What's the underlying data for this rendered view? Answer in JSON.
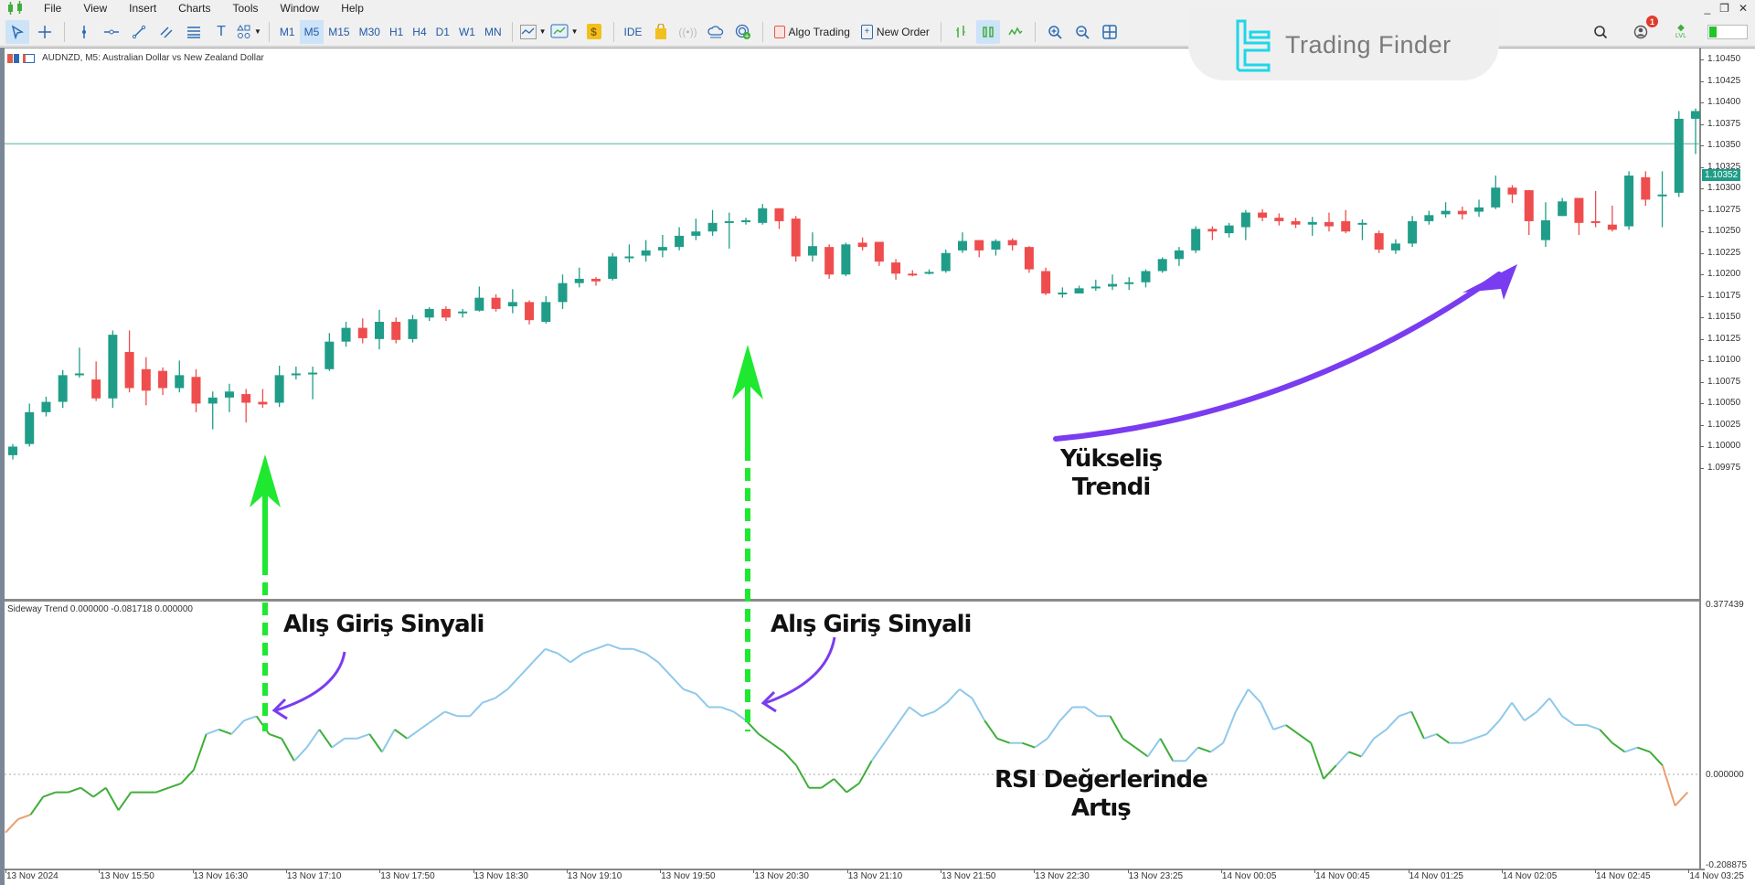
{
  "menu": {
    "items": [
      "File",
      "View",
      "Insert",
      "Charts",
      "Tools",
      "Window",
      "Help"
    ]
  },
  "toolbar": {
    "draw_tools": [
      "cursor-icon",
      "crosshair-icon",
      "vertical-line-icon",
      "horizontal-line-icon",
      "trendline-icon",
      "channel-icon",
      "fibonacci-icon",
      "text-icon",
      "shapes-icon"
    ],
    "timeframes": [
      "M1",
      "M5",
      "M15",
      "M30",
      "H1",
      "H4",
      "D1",
      "W1",
      "MN"
    ],
    "active_timeframe": "M5",
    "ide_label": "IDE",
    "algo_trading_label": "Algo Trading",
    "new_order_label": "New Order"
  },
  "window": {
    "minimize": "_",
    "restore": "❐",
    "close": "✕"
  },
  "notifications": {
    "count": "1"
  },
  "branding": {
    "name": "Trading Finder",
    "accent": "#1fd6e8"
  },
  "chart": {
    "symbol_title": "AUDNZD, M5:  Australian Dollar vs New Zealand Dollar",
    "current_price": "1.10352",
    "bull_color": "#1f9d88",
    "bear_color": "#ef4d4d"
  },
  "indicator": {
    "title": "Sideway Trend 0.000000 -0.081718 0.000000",
    "axis_top": "0.377439",
    "axis_zero": "0.000000",
    "axis_bottom": "-0.208875",
    "colors": {
      "neutral": "#8ec9ea",
      "up": "#3fae3a",
      "down": "#e8a070"
    }
  },
  "annotations": {
    "signal_1": "Alış Giriş Sinyali",
    "signal_2": "Alış Giriş Sinyali",
    "trend_line1": "Yükseliş",
    "trend_line2": "Trendi",
    "rsi_line1": "RSI Değerlerinde",
    "rsi_line2": "Artış",
    "arrow_color": "#7a3cf0",
    "signal_color": "#1ee830"
  },
  "chart_data": [
    {
      "type": "candlestick",
      "title": "AUDNZD, M5",
      "y_ticks": [
        "1.10450",
        "1.10425",
        "1.10400",
        "1.10375",
        "1.10350",
        "1.10325",
        "1.10300",
        "1.10275",
        "1.10250",
        "1.10225",
        "1.10200",
        "1.10175",
        "1.10150",
        "1.10125",
        "1.10100",
        "1.10075",
        "1.10050",
        "1.10025",
        "1.10000",
        "1.09975"
      ],
      "ylim": [
        1.0996,
        1.1048
      ],
      "x_ticks": [
        "13 Nov 2024",
        "13 Nov 15:50",
        "13 Nov 16:30",
        "13 Nov 17:10",
        "13 Nov 17:50",
        "13 Nov 18:30",
        "13 Nov 19:10",
        "13 Nov 19:50",
        "13 Nov 20:30",
        "13 Nov 21:10",
        "13 Nov 21:50",
        "13 Nov 22:30",
        "13 Nov 23:25",
        "14 Nov 00:05",
        "14 Nov 00:45",
        "14 Nov 01:25",
        "14 Nov 02:05",
        "14 Nov 02:45",
        "14 Nov 03:25"
      ],
      "horizontal_line": 1.10352,
      "ohlc": [
        [
          1.0999,
          1.1,
          1.09985,
          1.10003
        ],
        [
          1.10003,
          1.1004,
          1.1,
          1.1005
        ],
        [
          1.1004,
          1.10052,
          1.10035,
          1.10058
        ],
        [
          1.10052,
          1.10083,
          1.10045,
          1.10089
        ],
        [
          1.10083,
          1.10085,
          1.1008,
          1.10115
        ],
        [
          1.10078,
          1.10056,
          1.10053,
          1.10099
        ],
        [
          1.10056,
          1.1013,
          1.10045,
          1.10135
        ],
        [
          1.1011,
          1.10068,
          1.10063,
          1.10135
        ],
        [
          1.1009,
          1.10065,
          1.10048,
          1.10104
        ],
        [
          1.10088,
          1.10068,
          1.1006,
          1.10092
        ],
        [
          1.10068,
          1.10083,
          1.10063,
          1.101
        ],
        [
          1.10081,
          1.1005,
          1.1004,
          1.1009
        ],
        [
          1.1005,
          1.10057,
          1.1002,
          1.10064
        ],
        [
          1.10057,
          1.10064,
          1.1004,
          1.10073
        ],
        [
          1.10061,
          1.10051,
          1.10028,
          1.10067
        ],
        [
          1.10052,
          1.10049,
          1.10045,
          1.10067
        ],
        [
          1.10051,
          1.10083,
          1.10046,
          1.10094
        ],
        [
          1.10083,
          1.10085,
          1.10078,
          1.10093
        ],
        [
          1.10086,
          1.10086,
          1.10055,
          1.10093
        ],
        [
          1.1009,
          1.10122,
          1.10088,
          1.10132
        ],
        [
          1.10122,
          1.10138,
          1.10116,
          1.10145
        ],
        [
          1.10138,
          1.10126,
          1.1012,
          1.10149
        ],
        [
          1.10125,
          1.10145,
          1.10113,
          1.10159
        ],
        [
          1.10145,
          1.10124,
          1.1012,
          1.1015
        ],
        [
          1.10125,
          1.10148,
          1.10121,
          1.10153
        ],
        [
          1.1015,
          1.1016,
          1.10146,
          1.10162
        ],
        [
          1.1016,
          1.1015,
          1.10146,
          1.10163
        ],
        [
          1.10155,
          1.10157,
          1.1015,
          1.1016
        ],
        [
          1.10158,
          1.10173,
          1.10157,
          1.10186
        ],
        [
          1.10173,
          1.1016,
          1.10157,
          1.10177
        ],
        [
          1.10163,
          1.10168,
          1.10155,
          1.10183
        ],
        [
          1.10168,
          1.10147,
          1.10142,
          1.1017
        ],
        [
          1.10145,
          1.10168,
          1.10143,
          1.10175
        ],
        [
          1.10168,
          1.1019,
          1.1016,
          1.102
        ],
        [
          1.1019,
          1.10195,
          1.10185,
          1.10208
        ],
        [
          1.10195,
          1.10192,
          1.10187,
          1.10197
        ],
        [
          1.10195,
          1.10221,
          1.10193,
          1.10225
        ],
        [
          1.10221,
          1.10221,
          1.10214,
          1.10235
        ],
        [
          1.10222,
          1.10228,
          1.10215,
          1.1024
        ],
        [
          1.10228,
          1.10232,
          1.1022,
          1.10246
        ],
        [
          1.10232,
          1.10245,
          1.10228,
          1.10255
        ],
        [
          1.10245,
          1.1025,
          1.1024,
          1.10265
        ],
        [
          1.1025,
          1.1026,
          1.10245,
          1.10275
        ],
        [
          1.10262,
          1.10262,
          1.1023,
          1.10272
        ],
        [
          1.10262,
          1.10263,
          1.10258,
          1.10266
        ],
        [
          1.1026,
          1.10277,
          1.10258,
          1.10282
        ],
        [
          1.10277,
          1.10262,
          1.10253,
          1.10277
        ],
        [
          1.10265,
          1.10221,
          1.10215,
          1.10268
        ],
        [
          1.10222,
          1.10233,
          1.10215,
          1.10249
        ],
        [
          1.10232,
          1.102,
          1.10195,
          1.10235
        ],
        [
          1.102,
          1.10235,
          1.10198,
          1.10237
        ],
        [
          1.10237,
          1.10232,
          1.10228,
          1.10243
        ],
        [
          1.10238,
          1.10215,
          1.1021,
          1.10238
        ],
        [
          1.10214,
          1.10201,
          1.10194,
          1.10218
        ],
        [
          1.10201,
          1.10199,
          1.10198,
          1.10205
        ],
        [
          1.10201,
          1.10203,
          1.102,
          1.10206
        ],
        [
          1.10204,
          1.10225,
          1.10202,
          1.10229
        ],
        [
          1.10228,
          1.10239,
          1.10225,
          1.10249
        ],
        [
          1.1024,
          1.10228,
          1.1022,
          1.1024
        ],
        [
          1.10229,
          1.10239,
          1.10222,
          1.10241
        ],
        [
          1.1024,
          1.10234,
          1.10228,
          1.10242
        ],
        [
          1.10232,
          1.10206,
          1.10202,
          1.10233
        ],
        [
          1.10204,
          1.10178,
          1.10176,
          1.10208
        ],
        [
          1.10178,
          1.10179,
          1.10173,
          1.10185
        ],
        [
          1.10178,
          1.10184,
          1.10178,
          1.10187
        ],
        [
          1.10184,
          1.10186,
          1.10181,
          1.10194
        ],
        [
          1.10186,
          1.10189,
          1.10182,
          1.102
        ],
        [
          1.10189,
          1.10191,
          1.10182,
          1.10197
        ],
        [
          1.10191,
          1.10204,
          1.10185,
          1.10206
        ],
        [
          1.10204,
          1.10218,
          1.10202,
          1.1022
        ],
        [
          1.10218,
          1.10228,
          1.1021,
          1.10232
        ],
        [
          1.10228,
          1.10253,
          1.10225,
          1.10256
        ],
        [
          1.10253,
          1.1025,
          1.1024,
          1.10256
        ],
        [
          1.10248,
          1.10257,
          1.10243,
          1.1026
        ],
        [
          1.10255,
          1.10272,
          1.1024,
          1.10275
        ],
        [
          1.10272,
          1.10266,
          1.10262,
          1.10276
        ],
        [
          1.10266,
          1.10262,
          1.10257,
          1.10271
        ],
        [
          1.10262,
          1.10258,
          1.10254,
          1.10266
        ],
        [
          1.10258,
          1.10261,
          1.10245,
          1.10267
        ],
        [
          1.10261,
          1.10256,
          1.1025,
          1.10272
        ],
        [
          1.10262,
          1.1025,
          1.10248,
          1.10275
        ],
        [
          1.10258,
          1.1026,
          1.1024,
          1.10264
        ],
        [
          1.10248,
          1.10229,
          1.10225,
          1.10251
        ],
        [
          1.10228,
          1.10236,
          1.10224,
          1.10241
        ],
        [
          1.10236,
          1.10262,
          1.10232,
          1.10268
        ],
        [
          1.10262,
          1.10269,
          1.10258,
          1.10274
        ],
        [
          1.1027,
          1.10274,
          1.10266,
          1.10284
        ],
        [
          1.10274,
          1.1027,
          1.10264,
          1.10279
        ],
        [
          1.10273,
          1.10278,
          1.10267,
          1.10287
        ],
        [
          1.10278,
          1.10301,
          1.10276,
          1.10315
        ],
        [
          1.10301,
          1.10293,
          1.10283,
          1.10304
        ],
        [
          1.10298,
          1.10262,
          1.10246,
          1.10298
        ],
        [
          1.1024,
          1.10263,
          1.10232,
          1.10284
        ],
        [
          1.10268,
          1.10285,
          1.10268,
          1.10289
        ],
        [
          1.10289,
          1.1026,
          1.10246,
          1.10289
        ],
        [
          1.10262,
          1.10261,
          1.10255,
          1.10297
        ],
        [
          1.10258,
          1.10252,
          1.1025,
          1.1028
        ],
        [
          1.10256,
          1.10315,
          1.10252,
          1.1032
        ],
        [
          1.10313,
          1.10287,
          1.1028,
          1.1032
        ],
        [
          1.10292,
          1.10293,
          1.10255,
          1.1032
        ],
        [
          1.10295,
          1.10381,
          1.1029,
          1.1039
        ],
        [
          1.10381,
          1.1039,
          1.1034,
          1.10393
        ]
      ]
    },
    {
      "type": "line",
      "title": "Sideway Trend",
      "ylim": [
        -0.208875,
        0.377439
      ],
      "zero_line": 0.0,
      "values": [
        -0.13,
        -0.1,
        -0.09,
        -0.05,
        -0.04,
        -0.04,
        -0.03,
        -0.05,
        -0.03,
        -0.08,
        -0.04,
        -0.04,
        -0.04,
        -0.03,
        -0.02,
        0.01,
        0.09,
        0.1,
        0.09,
        0.12,
        0.13,
        0.09,
        0.08,
        0.03,
        0.06,
        0.1,
        0.06,
        0.08,
        0.08,
        0.09,
        0.05,
        0.1,
        0.08,
        0.1,
        0.12,
        0.14,
        0.13,
        0.13,
        0.16,
        0.17,
        0.19,
        0.22,
        0.25,
        0.28,
        0.27,
        0.25,
        0.27,
        0.28,
        0.29,
        0.28,
        0.28,
        0.27,
        0.25,
        0.22,
        0.19,
        0.18,
        0.15,
        0.15,
        0.14,
        0.12,
        0.09,
        0.07,
        0.05,
        0.02,
        -0.03,
        -0.03,
        -0.01,
        -0.04,
        -0.02,
        0.03,
        0.07,
        0.11,
        0.15,
        0.13,
        0.14,
        0.16,
        0.19,
        0.17,
        0.12,
        0.08,
        0.07,
        0.07,
        0.06,
        0.08,
        0.12,
        0.15,
        0.15,
        0.13,
        0.13,
        0.08,
        0.06,
        0.04,
        0.08,
        0.03,
        0.03,
        0.06,
        0.05,
        0.07,
        0.14,
        0.19,
        0.16,
        0.1,
        0.11,
        0.09,
        0.07,
        -0.01,
        0.02,
        0.05,
        0.04,
        0.08,
        0.1,
        0.13,
        0.14,
        0.08,
        0.09,
        0.07,
        0.07,
        0.08,
        0.09,
        0.12,
        0.16,
        0.12,
        0.14,
        0.17,
        0.13,
        0.11,
        0.11,
        0.1,
        0.07,
        0.05,
        0.06,
        0.05,
        0.02,
        -0.07,
        -0.04
      ]
    }
  ]
}
